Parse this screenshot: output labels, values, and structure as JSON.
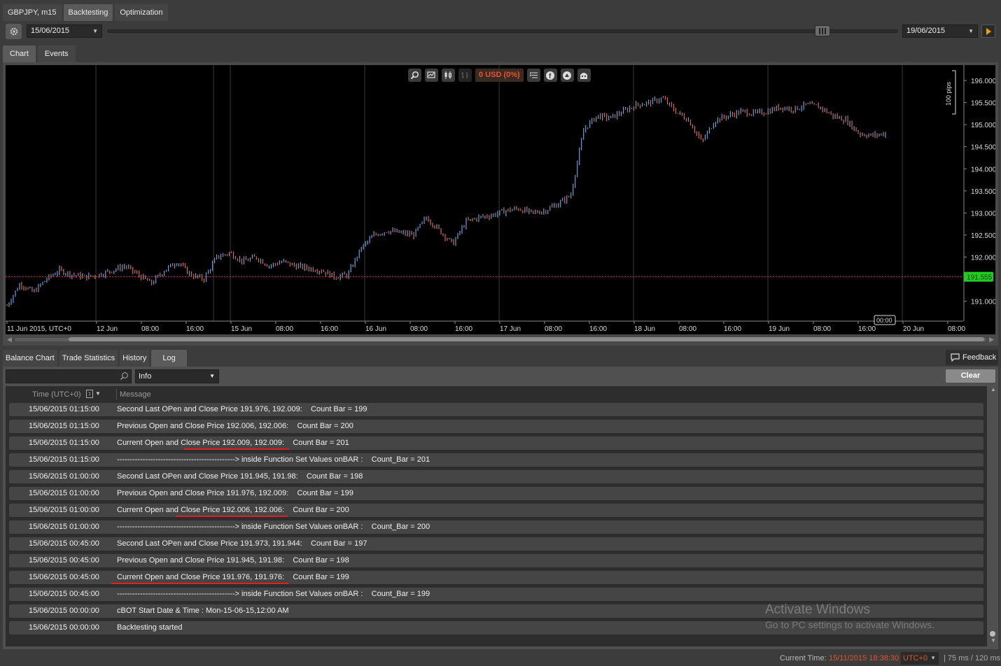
{
  "top_tabs": [
    "GBPJPY, m15",
    "Backtesting",
    "Optimization"
  ],
  "toolbar": {
    "start_date": "15/06/2015",
    "end_date": "19/06/2015"
  },
  "chart_tabs": [
    "Chart",
    "Events"
  ],
  "chart_toolbar": {
    "pl_label": "0 USD (0%)",
    "icons": [
      "zoom-icon",
      "chart-settings-icon",
      "candle-type-icon",
      "bar-type-icon"
    ],
    "icons_right": [
      "list-icon",
      "facebook-icon",
      "trade-icon",
      "cbot-icon"
    ]
  },
  "chart_data": {
    "type": "line",
    "symbol": "GBPJPY",
    "timeframe": "m15",
    "current_price_label": "191.555",
    "current_price": 191.555,
    "y_ticks": [
      "196.000",
      "195.500",
      "195.000",
      "194.500",
      "194.000",
      "193.500",
      "193.000",
      "192.500",
      "192.000",
      "191.000"
    ],
    "y_tick_values": [
      196.0,
      195.5,
      195.0,
      194.5,
      194.0,
      193.5,
      193.0,
      192.5,
      192.0,
      191.0
    ],
    "ylim": [
      190.55,
      196.35
    ],
    "x_ticks": [
      "11 Jun 2015, UTC+0",
      "12 Jun",
      "08:00",
      "16:00",
      "15 Jun",
      "08:00",
      "16:00",
      "16 Jun",
      "08:00",
      "16:00",
      "17 Jun",
      "08:00",
      "16:00",
      "18 Jun",
      "08:00",
      "16:00",
      "19 Jun",
      "08:00",
      "16:00",
      "20 Jun",
      "08:00"
    ],
    "pips_label": "100 pips",
    "time_marker_label": "00:00",
    "grid": true,
    "series": [
      {
        "values": [
          190.9,
          191.4,
          191.2,
          191.5,
          191.7,
          191.6,
          191.55,
          191.6,
          191.7,
          191.8,
          191.6,
          191.4,
          191.7,
          191.9,
          191.6,
          191.5,
          192.0,
          192.1,
          191.9,
          192.0,
          191.8,
          191.9,
          191.8,
          191.75,
          191.7,
          191.55,
          191.6,
          192.2,
          192.5,
          192.6,
          192.55,
          192.5,
          192.9,
          192.6,
          192.3,
          192.8,
          192.9,
          192.95,
          193.05,
          193.1,
          193.0,
          193.05,
          193.2,
          193.4,
          194.9,
          195.2,
          195.15,
          195.3,
          195.45,
          195.5,
          195.6,
          195.3,
          195.1,
          194.6,
          195.1,
          195.2,
          195.3,
          195.25,
          195.3,
          195.4,
          195.35,
          195.45,
          195.4,
          195.2,
          195.1,
          194.8,
          194.75,
          194.8
        ]
      }
    ]
  },
  "bottom_tabs": [
    "Balance Chart",
    "Trade Statistics",
    "History",
    "Log"
  ],
  "feedback_label": "Feedback",
  "log": {
    "filter_placeholder": "",
    "level": "Info",
    "clear_label": "Clear",
    "columns": [
      "Time (UTC+0)",
      "Message"
    ],
    "rows": [
      {
        "time": "15/06/2015 01:15:00",
        "message": "Second Last OPen and Close Price 191.976, 192.009:    Count Bar = 199"
      },
      {
        "time": "15/06/2015 01:15:00",
        "message": "Previous Open and Close Price 192.006, 192.006:    Count Bar = 200"
      },
      {
        "time": "15/06/2015 01:15:00",
        "message": "Current Open and Close Price 192.009, 192.009:    Count Bar = 201",
        "underline": true
      },
      {
        "time": "15/06/2015 01:15:00",
        "message": "----------------------------------------------> inside Function Set Values onBAR :    Count_Bar = 201"
      },
      {
        "time": "15/06/2015 01:00:00",
        "message": "Second Last OPen and Close Price 191.945, 191.98:    Count Bar = 198"
      },
      {
        "time": "15/06/2015 01:00:00",
        "message": "Previous Open and Close Price 191.976, 192.009:    Count Bar = 199"
      },
      {
        "time": "15/06/2015 01:00:00",
        "message": "Current Open and Close Price 192.006, 192.006:    Count Bar = 200",
        "underline": true
      },
      {
        "time": "15/06/2015 01:00:00",
        "message": "----------------------------------------------> inside Function Set Values onBAR :    Count_Bar = 200"
      },
      {
        "time": "15/06/2015 00:45:00",
        "message": "Second Last OPen and Close Price 191.973, 191.944:    Count Bar = 197"
      },
      {
        "time": "15/06/2015 00:45:00",
        "message": "Previous Open and Close Price 191.945, 191.98:    Count Bar = 198"
      },
      {
        "time": "15/06/2015 00:45:00",
        "message": "Current Open and Close Price 191.976, 191.976:    Count Bar = 199",
        "underline": true
      },
      {
        "time": "15/06/2015 00:45:00",
        "message": "----------------------------------------------> inside Function Set Values onBAR :    Count_Bar = 199"
      },
      {
        "time": "15/06/2015 00:00:00",
        "message": "cBOT Start Date & Time : Mon-15-06-15,12:00 AM"
      },
      {
        "time": "15/06/2015 00:00:00",
        "message": "Backtesting started"
      }
    ]
  },
  "watermark": {
    "line1": "Activate Windows",
    "line2": "Go to PC settings to activate Windows."
  },
  "status": {
    "label": "Current Time:",
    "time": "15/11/2015 18:38:30",
    "timezone": "UTC+0",
    "ping": "| 75 ms / 120 ms"
  },
  "colors": {
    "accent_orange": "#f0a000",
    "price_line": "#e03020",
    "price_badge": "#22cc22",
    "candle_up": "#6aa0d8",
    "candle_down": "#d86a5a"
  }
}
